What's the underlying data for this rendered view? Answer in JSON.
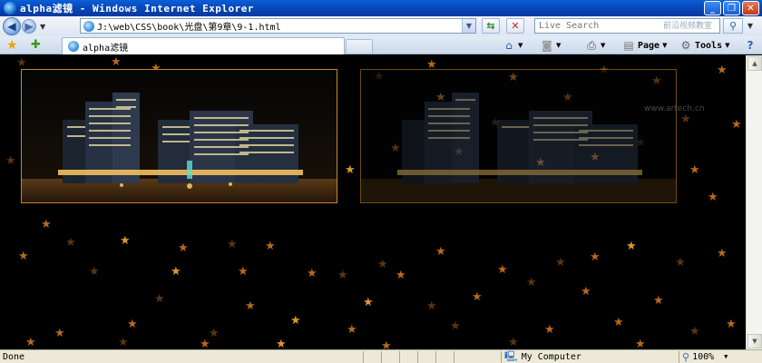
{
  "window": {
    "title": "alpha滤镜 - Windows Internet Explorer",
    "minimize_icon": "minimize-icon",
    "maximize_icon": "maximize-icon",
    "close_icon": "close-icon"
  },
  "addressbar": {
    "url": "J:\\web\\CSS\\book\\光盘\\第9章\\9-1.html",
    "search_placeholder": "Live Search",
    "watermark": "前沿视频教室"
  },
  "tabs": [
    {
      "label": "alpha滤镜"
    }
  ],
  "commands": {
    "page_label": "Page",
    "tools_label": "Tools"
  },
  "content": {
    "watermark": "www.artech.cn",
    "left_image_alpha": 1.0,
    "right_image_alpha": 0.55
  },
  "statusbar": {
    "status": "Done",
    "zone": "My Computer",
    "zoom": "100%"
  },
  "colors": {
    "titlebar": "#0846b8",
    "frame_border": "#c88a2a",
    "background": "#000000"
  }
}
